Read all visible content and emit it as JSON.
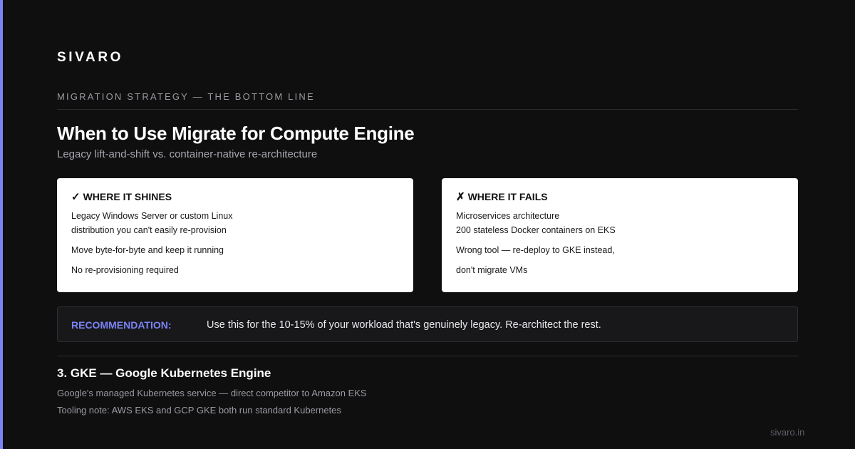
{
  "brand": "SIVARO",
  "eyebrow": "MIGRATION STRATEGY — THE BOTTOM LINE",
  "title": "When to Use Migrate for Compute Engine",
  "subtitle": "Legacy lift-and-shift vs. container-native re-architecture",
  "colors": {
    "accent": "#7b84f4",
    "background": "#0f0f10",
    "card": "#ffffff"
  },
  "shines": {
    "icon": "check-icon",
    "glyph": "✓",
    "heading": "WHERE IT SHINES",
    "lines": [
      "Legacy Windows Server or custom Linux",
      "distribution you can't easily re-provision",
      "Move byte-for-byte and keep it running",
      "No re-provisioning required"
    ]
  },
  "fails": {
    "icon": "cross-icon",
    "glyph": "✗",
    "heading": "WHERE IT FAILS",
    "lines": [
      "Microservices architecture",
      "200 stateless Docker containers on EKS",
      "Wrong tool — re-deploy to GKE instead,",
      "don't migrate VMs"
    ]
  },
  "recommendation": {
    "label": "RECOMMENDATION:",
    "text": "Use this for the 10-15% of your workload that's genuinely legacy. Re-architect the rest."
  },
  "section": {
    "heading": "3. GKE — Google Kubernetes Engine",
    "lines": [
      "Google's managed Kubernetes service — direct competitor to Amazon EKS",
      "Tooling note: AWS EKS and GCP GKE both run standard Kubernetes"
    ]
  },
  "footer": "sivaro.in"
}
